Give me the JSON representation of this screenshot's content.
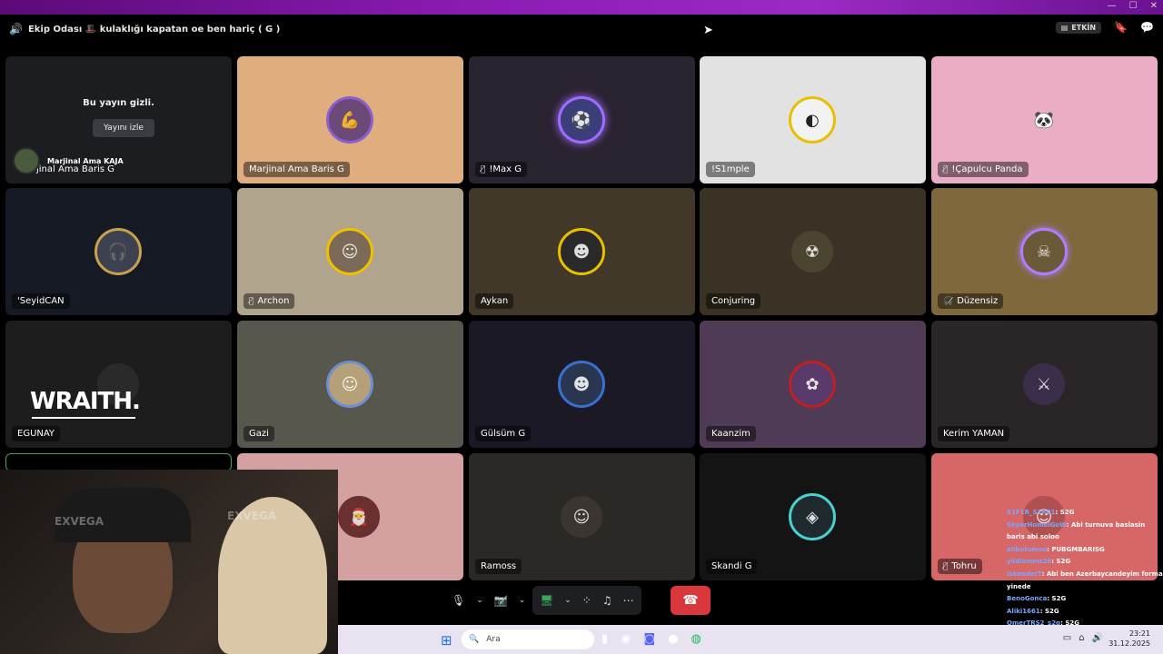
{
  "window": {
    "minimize": "—",
    "maximize": "☐",
    "close": "✕"
  },
  "header": {
    "room_title": "Ekip Odası 🎩 kulaklığı kapatan oe ben hariç ( G )",
    "active_label": "ETKİN"
  },
  "hidden_stream": {
    "message": "Bu yayın gizli.",
    "watch_label": "Yayını izle",
    "streamer_name": "Marjinal Ama KAJA",
    "partial_name": "jinal Ama Baris G"
  },
  "participants": [
    {
      "name": "Marjinal Ama Baris G",
      "muted": false,
      "bg": "#e0ad7e"
    },
    {
      "name": "!Max G",
      "muted": true,
      "bg": "#2a2330"
    },
    {
      "name": "!S1mple",
      "muted": false,
      "bg": "#e2e2e2"
    },
    {
      "name": "!Çapulcu Panda",
      "muted": true,
      "bg": "#ebacc6"
    },
    {
      "name": "'SeyidCAN",
      "muted": false,
      "bg": "#151a24"
    },
    {
      "name": "Archon",
      "muted": true,
      "bg": "#b1a48c"
    },
    {
      "name": "Aykan",
      "muted": false,
      "bg": "#413829"
    },
    {
      "name": "Conjuring",
      "muted": false,
      "bg": "#3a3325"
    },
    {
      "name": "Düzensiz",
      "muted": true,
      "bg": "#7e683c"
    },
    {
      "name": "EGUNAY",
      "muted": false,
      "bg": "#1d1d1d"
    },
    {
      "name": "Gazi",
      "muted": false,
      "bg": "#58574e"
    },
    {
      "name": "Gülsüm G",
      "muted": false,
      "bg": "#1b1925"
    },
    {
      "name": "Kaanzim",
      "muted": false,
      "bg": "#4f3b55"
    },
    {
      "name": "Kerim YAMAN",
      "muted": false,
      "bg": "#2a2526"
    },
    {
      "name": "",
      "muted": false,
      "bg": "#d4a0a0"
    },
    {
      "name": "Ramoss",
      "muted": false,
      "bg": "#2b2926"
    },
    {
      "name": "Skandi G",
      "muted": false,
      "bg": "#141414"
    },
    {
      "name": "Tohru",
      "muted": true,
      "bg": "#d76666"
    }
  ],
  "egunay_logo": "WRAITH.",
  "chat": [
    {
      "user": "S1F1R_S1R01",
      "text": ": S2G"
    },
    {
      "user": "SkyorHomelGoW",
      "text": ": Abi turnuva baslasin baris abi soloo"
    },
    {
      "user": "alibotumsu",
      "text": ": PUBGMBARISG"
    },
    {
      "user": "yildizmmz26",
      "text": ": S2G"
    },
    {
      "user": "IskenderT",
      "text": ": Abi ben Azerbaycandeyim forma yinede"
    },
    {
      "user": "BenoGonca",
      "text": ": S2G"
    },
    {
      "user": "Aliki1661",
      "text": ": S2G"
    },
    {
      "user": "OmerTRS2_s2g",
      "text": ": S2G"
    }
  ],
  "taskbar": {
    "search_placeholder": "Ara",
    "time": "23:21",
    "date": "31.12.2025"
  },
  "webcam_labels": {
    "left": "EXVEGA",
    "right": "EXVEGA"
  }
}
